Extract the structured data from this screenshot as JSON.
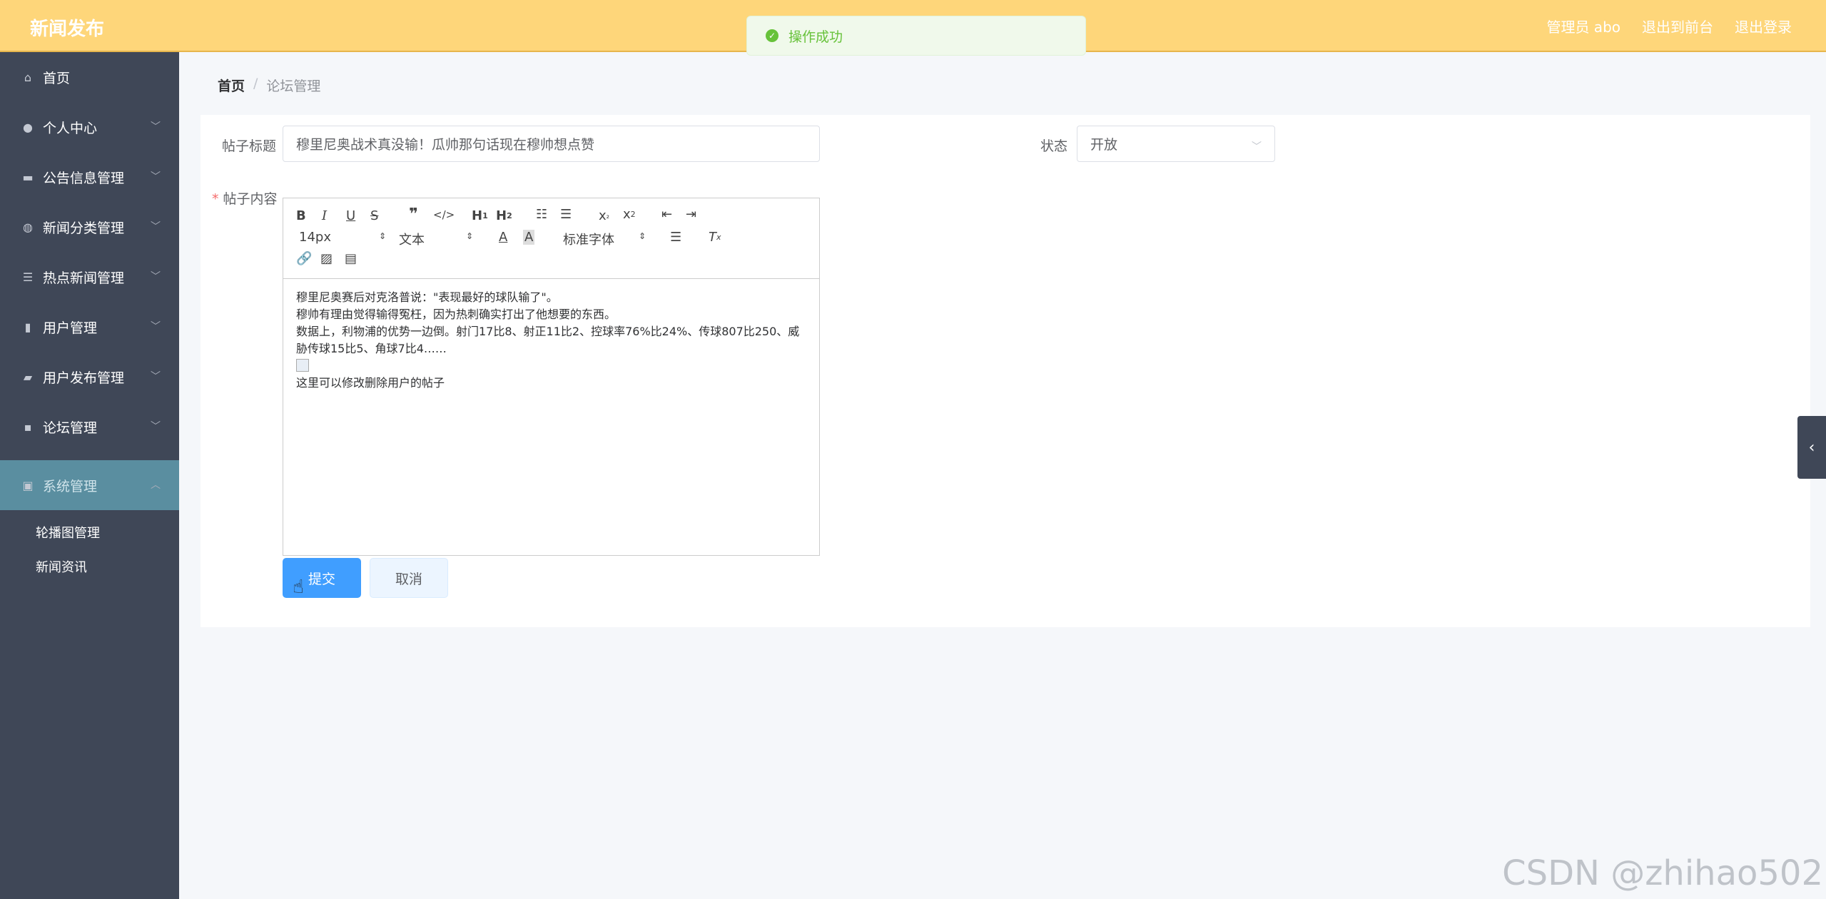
{
  "header": {
    "brand": "新闻发布",
    "admin_label": "管理员 abo",
    "back_to_front": "退出到前台",
    "logout": "退出登录"
  },
  "toast": {
    "message": "操作成功"
  },
  "sidebar": {
    "items": [
      {
        "label": "首页",
        "icon": "home-icon"
      },
      {
        "label": "个人中心",
        "icon": "user-icon"
      },
      {
        "label": "公告信息管理",
        "icon": "monitor-icon"
      },
      {
        "label": "新闻分类管理",
        "icon": "globe-icon"
      },
      {
        "label": "热点新闻管理",
        "icon": "list-icon"
      },
      {
        "label": "用户管理",
        "icon": "book-icon"
      },
      {
        "label": "用户发布管理",
        "icon": "briefcase-icon"
      },
      {
        "label": "论坛管理",
        "icon": "chat-icon"
      }
    ],
    "active": {
      "label": "系统管理",
      "icon": "clipboard-icon"
    },
    "sub_items": [
      "轮播图管理",
      "新闻资讯"
    ]
  },
  "breadcrumb": {
    "home": "首页",
    "separator": "/",
    "current": "论坛管理"
  },
  "form": {
    "title_label": "帖子标题",
    "title_value": "穆里尼奥战术真没输！瓜帅那句话现在穆帅想点赞",
    "status_label": "状态",
    "status_value": "开放",
    "content_label": "帖子内容",
    "required_mark": "*"
  },
  "editor": {
    "font_size": "14px",
    "header_select": "文本",
    "font_family": "标准字体",
    "content_lines": [
      "穆里尼奥赛后对克洛普说：\"表现最好的球队输了\"。",
      "穆帅有理由觉得输得冤枉，因为热刺确实打出了他想要的东西。",
      "数据上，利物浦的优势一边倒。射门17比8、射正11比2、控球率76%比24%、传球807比250、威胁传球15比5、角球7比4……",
      "这里可以修改删除用户的帖子"
    ]
  },
  "buttons": {
    "submit": "提交",
    "cancel": "取消"
  },
  "watermark": "CSDN @zhihao502"
}
